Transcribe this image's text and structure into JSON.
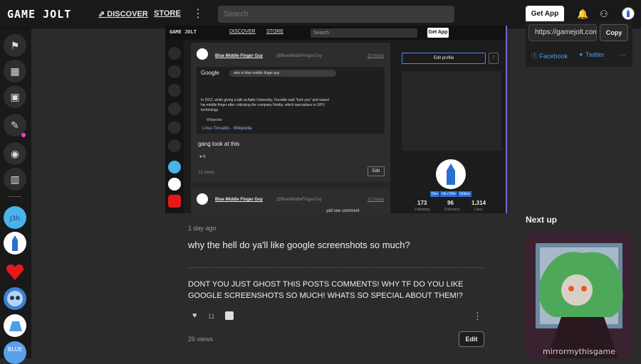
{
  "header": {
    "logo": "GAME JOLT",
    "nav": [
      "DISCOVER",
      "STORE"
    ],
    "search_placeholder": "Search",
    "get_app": "Get App",
    "icons": [
      "bell-icon",
      "friends-icon",
      "user-avatar"
    ]
  },
  "sidebar": {
    "items": [
      "backpack-icon",
      "store-icon",
      "inventory-icon",
      "quests-icon",
      "realms-icon",
      "library-icon"
    ],
    "games": [
      "realm-game-1",
      "blue-character",
      "heart-game",
      "robot-game",
      "blue-mascot",
      "blue-game"
    ]
  },
  "screenshot": {
    "header": {
      "logo": "GAME JOLT",
      "discover": "DISCOVER",
      "store": "STORE",
      "search": "Search",
      "get_app": "Get App"
    },
    "post": {
      "author": "Blue Middle Finger Guy",
      "handle": "@BlueMiddleFingerGuy",
      "time": "20 hours",
      "caption": "gang look at this",
      "likes": "6",
      "views": "13 views",
      "edit": "Edit"
    },
    "google": {
      "query": "who is blue middle finger guy",
      "snippet": "In 2012, while giving a talk at Aalto University, Torvalds said \"fuck you\" and raised his middle finger after criticizing the company Nvidia, which specializes in GPU technology.",
      "source": "Wikipedia",
      "link": "Linus Torvalds - Wikipedia"
    },
    "post2": {
      "author": "Blue Middle Finger Guy",
      "handle": "@BlueMiddleFingerGuy",
      "time": "21 hours",
      "text": "yall see comment"
    },
    "profile": {
      "edit_profile": "Edit profile",
      "badges": [
        "Dev",
        "He / Him",
        "Online"
      ],
      "stats": [
        {
          "value": "173",
          "label": "Following"
        },
        {
          "value": "96",
          "label": "Followers"
        },
        {
          "value": "1,314",
          "label": "Likes"
        }
      ]
    }
  },
  "post": {
    "time_ago": "1 day ago",
    "title": "why the hell do ya'll like google screenshots so much?",
    "body": "DONT YOU JUST GHOST THIS POSTS COMMENTS! WHY TF DO YOU LIKE GOOGLE SCREENSHOTS SO MUCH! WHATS SO SPECIAL ABOUT THEM!?",
    "likes": "11",
    "views": "26 views",
    "edit": "Edit"
  },
  "share": {
    "url": "https://gamejolt.com",
    "copy": "Copy",
    "facebook": "Facebook",
    "twitter": "Twitter",
    "more": "..."
  },
  "next_up": {
    "label": "Next up",
    "thumb_caption": "mirrormythisgame"
  }
}
